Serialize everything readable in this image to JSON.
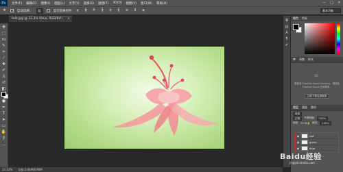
{
  "app": {
    "logo": "Ps"
  },
  "menu": [
    "文件(F)",
    "编辑(E)",
    "图像(I)",
    "图层(L)",
    "文字(Y)",
    "选择(S)",
    "滤镜(T)",
    "3D(D)",
    "视图(V)",
    "窗口(W)",
    "帮助(H)"
  ],
  "window_controls": [
    "—",
    "□",
    "✕"
  ],
  "options": {
    "auto_select_label": "自动选择：",
    "auto_select_value": "组",
    "show_transform_label": "显示变换控件",
    "workspace": "基本功能"
  },
  "document": {
    "tab_title": "test.jpg @ 33.3% (blue, RGB/8#)",
    "close": "×"
  },
  "status": {
    "zoom": "33.33%",
    "doc_size": "文档:2.64M/8.90M"
  },
  "panels": {
    "color_tabs": [
      "颜色",
      "色板"
    ],
    "libraries_tabs": [
      "库",
      "调整",
      "样式"
    ],
    "libraries_text": "要使用 Creative Cloud Libraries，请安装 Creative Cloud 应用程序。",
    "libraries_button": "立即下载应用程序",
    "layers_tabs": [
      "图层",
      "通道",
      "路径"
    ],
    "layers_kind": "类型",
    "layers_mode": "正常",
    "layers_opacity_label": "不透明度:",
    "layers_opacity": "100%",
    "layers_lock_label": "锁定:",
    "layers_fill_label": "填充:",
    "layers_fill": "100%",
    "layers": [
      {
        "name": "red"
      },
      {
        "name": "green"
      },
      {
        "name": "blue"
      }
    ]
  },
  "watermark": {
    "main": "Baidu经验",
    "sub": "jingyan.baidu.com"
  },
  "colors": {
    "highlight": "#d23030",
    "panel_bg": "#535353",
    "canvas_bg": "#282828"
  },
  "icons": [
    "move-tool-icon",
    "marquee-tool-icon",
    "lasso-tool-icon",
    "crop-tool-icon",
    "eyedropper-icon",
    "brush-tool-icon",
    "eraser-tool-icon",
    "type-tool-icon",
    "hand-tool-icon",
    "zoom-tool-icon",
    "eye-icon",
    "creative-cloud-icon"
  ]
}
